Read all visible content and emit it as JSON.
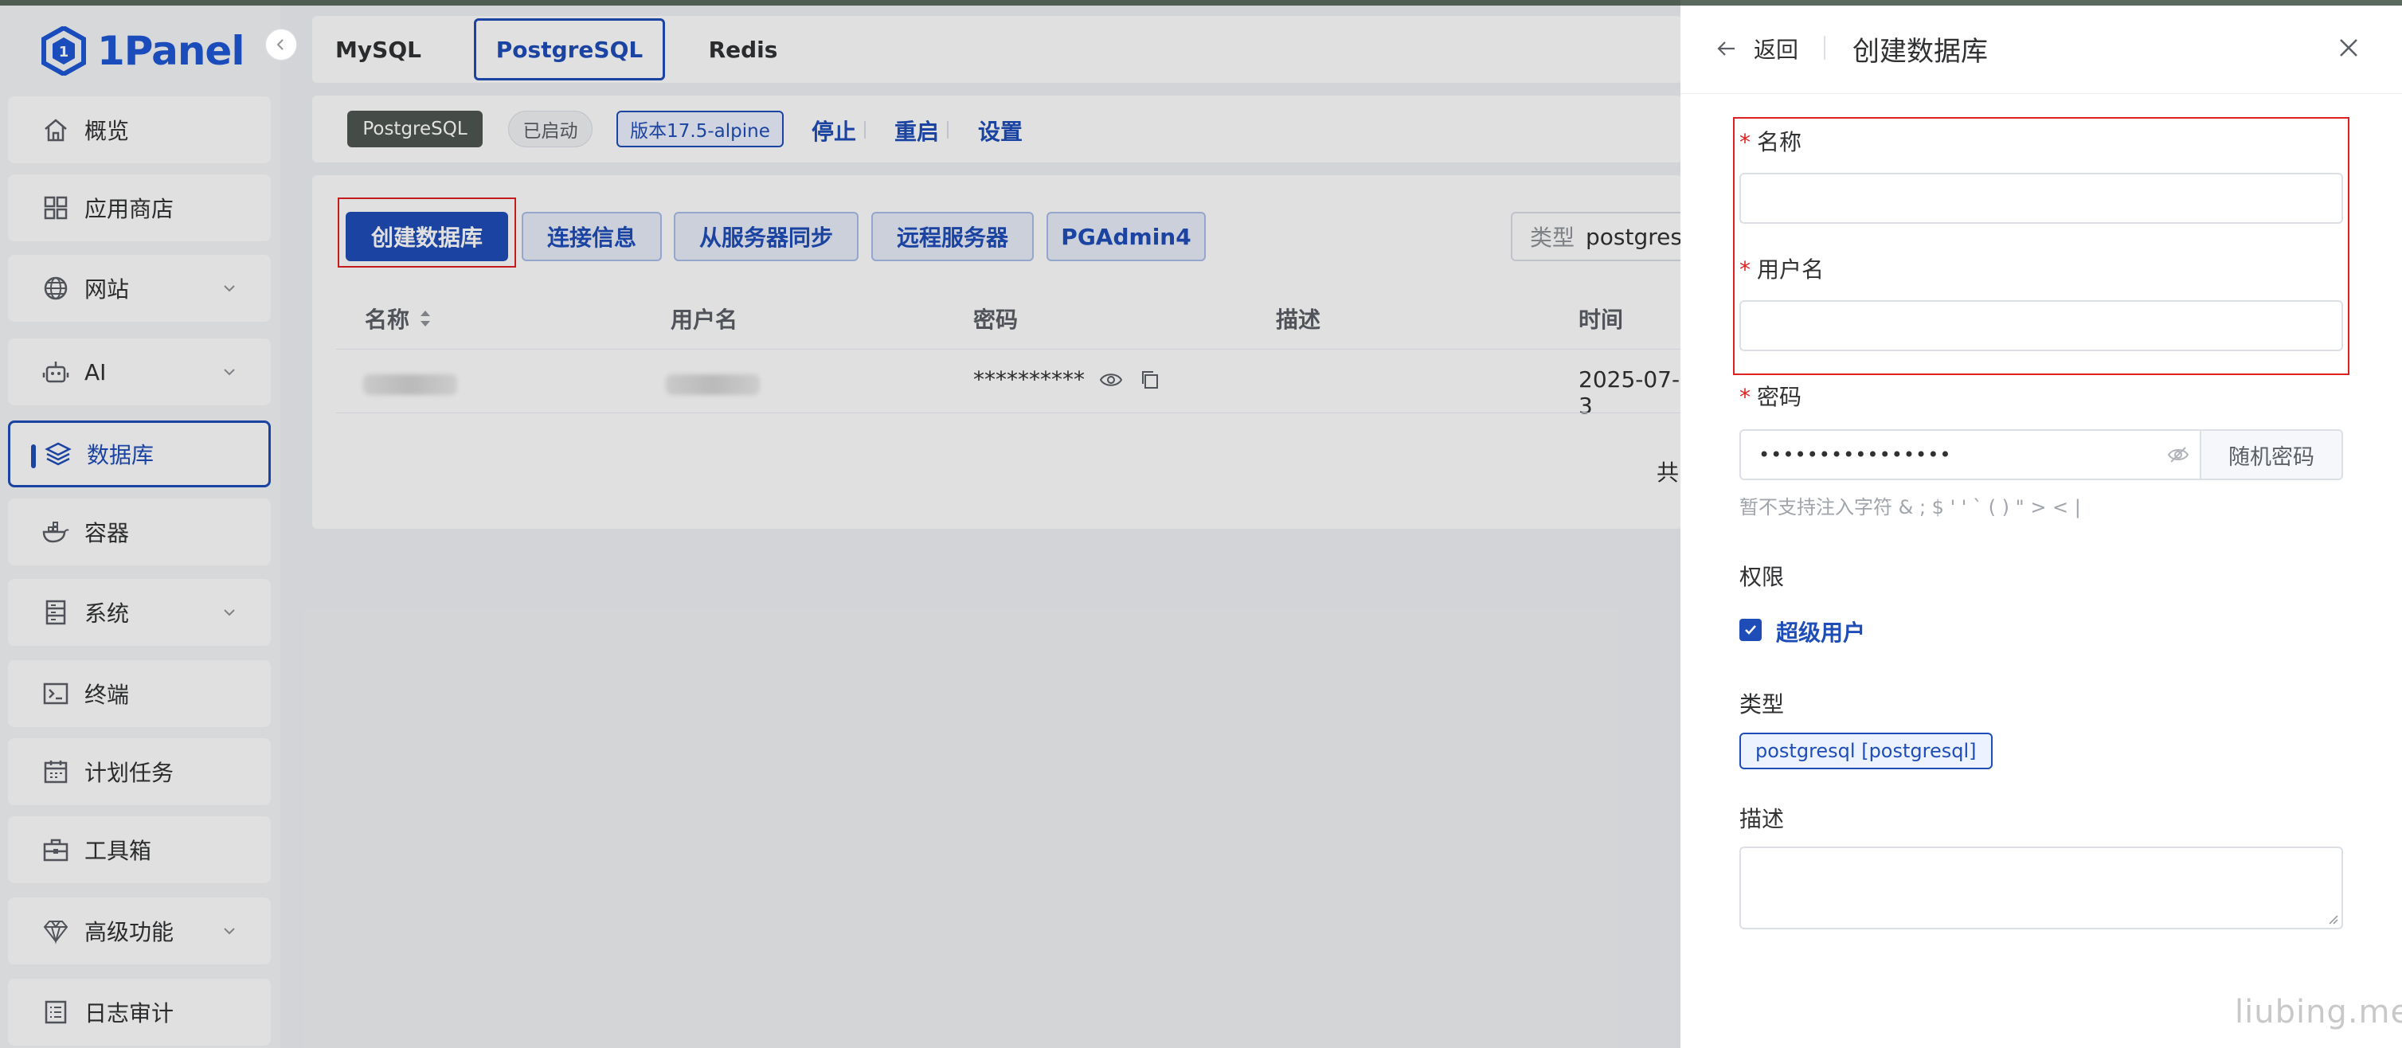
{
  "app": {
    "brand": "1Panel",
    "accent": "#1f4db8",
    "highlight_border": "#e02020"
  },
  "sidebar": {
    "items": [
      {
        "label": "概览",
        "icon": "home-icon",
        "expandable": false,
        "active": false
      },
      {
        "label": "应用商店",
        "icon": "apps-grid-icon",
        "expandable": false,
        "active": false
      },
      {
        "label": "网站",
        "icon": "globe-icon",
        "expandable": true,
        "active": false
      },
      {
        "label": "AI",
        "icon": "robot-icon",
        "expandable": true,
        "active": false
      },
      {
        "label": "数据库",
        "icon": "layers-icon",
        "expandable": false,
        "active": true
      },
      {
        "label": "容器",
        "icon": "docker-whale-icon",
        "expandable": false,
        "active": false
      },
      {
        "label": "系统",
        "icon": "server-icon",
        "expandable": true,
        "active": false
      },
      {
        "label": "终端",
        "icon": "terminal-icon",
        "expandable": false,
        "active": false
      },
      {
        "label": "计划任务",
        "icon": "calendar-icon",
        "expandable": false,
        "active": false
      },
      {
        "label": "工具箱",
        "icon": "toolbox-icon",
        "expandable": false,
        "active": false
      },
      {
        "label": "高级功能",
        "icon": "diamond-icon",
        "expandable": true,
        "active": false
      },
      {
        "label": "日志审计",
        "icon": "log-icon",
        "expandable": false,
        "active": false
      }
    ]
  },
  "tabs": [
    {
      "label": "MySQL",
      "active": false
    },
    {
      "label": "PostgreSQL",
      "active": true
    },
    {
      "label": "Redis",
      "active": false
    }
  ],
  "status": {
    "app_tag": "PostgreSQL",
    "state_tag": "已启动",
    "version_tag": "版本17.5-alpine",
    "actions": [
      "停止",
      "重启",
      "设置"
    ]
  },
  "toolbar": {
    "create": "创建数据库",
    "conn_info": "连接信息",
    "sync": "从服务器同步",
    "remote": "远程服务器",
    "pgadmin": "PGAdmin4",
    "type_label": "类型",
    "type_value": "postgresql"
  },
  "table": {
    "headers": [
      "名称",
      "用户名",
      "密码",
      "描述",
      "时间"
    ],
    "rows": [
      {
        "password": "**********",
        "time": "2025-07-3"
      }
    ],
    "pager_prefix": "共"
  },
  "drawer": {
    "back": "返回",
    "title": "创建数据库",
    "name_label": "名称",
    "name_value": "",
    "username_label": "用户名",
    "username_value": "",
    "password_label": "密码",
    "password_value": "••••••••••••••••",
    "random_password": "随机密码",
    "password_hint": "暂不支持注入字符 & ; $ ' ' ` ( ) \" > < |",
    "permission_label": "权限",
    "superuser_label": "超级用户",
    "superuser_checked": true,
    "type_label": "类型",
    "type_tag": "postgresql [postgresql]",
    "desc_label": "描述",
    "desc_value": ""
  },
  "watermark": "liubing.me"
}
